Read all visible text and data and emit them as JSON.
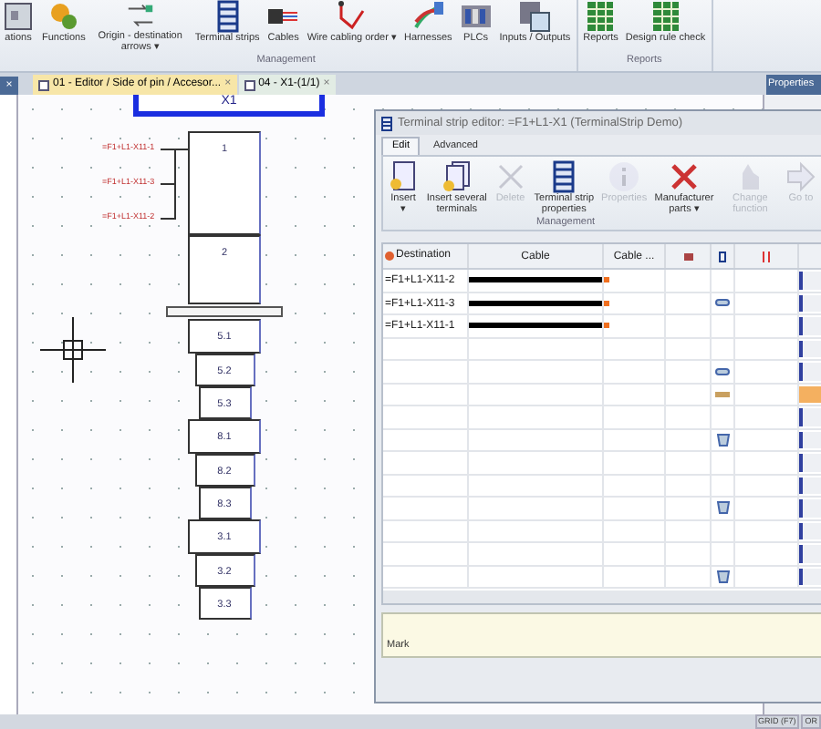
{
  "ribbon": {
    "groups": [
      {
        "label": "Management",
        "items": [
          {
            "label": "ations"
          },
          {
            "label": "Functions"
          },
          {
            "label": "Origin - destination arrows",
            "caret": "▾"
          },
          {
            "label": "Terminal strips"
          },
          {
            "label": "Cables"
          },
          {
            "label": "Wire cabling order",
            "caret": "▾"
          },
          {
            "label": "Harnesses"
          },
          {
            "label": "PLCs"
          },
          {
            "label": "Inputs / Outputs"
          }
        ]
      },
      {
        "label": "Reports",
        "items": [
          {
            "label": "Reports"
          },
          {
            "label": "Design rule check"
          }
        ]
      }
    ]
  },
  "left_panel": {
    "close": "×"
  },
  "doc_tabs": [
    {
      "label": "01 - Editor / Side of pin / Accesor...",
      "close": "×",
      "selected": false
    },
    {
      "label": "04 - X1-(1/1)",
      "close": "×",
      "selected": true
    }
  ],
  "properties_panel": {
    "title": "Properties"
  },
  "diagram": {
    "strip_title": "X1",
    "wire_labels": [
      "=F1+L1-X11-1",
      "=F1+L1-X11-3",
      "=F1+L1-X11-2"
    ],
    "terminals": [
      {
        "label": "1",
        "kind": "large"
      },
      {
        "label": "2",
        "kind": "medium"
      },
      {
        "kind": "bar"
      },
      {
        "label": "5.1",
        "kind": "wide"
      },
      {
        "label": "5.2",
        "kind": "mid"
      },
      {
        "label": "5.3",
        "kind": "narrow"
      },
      {
        "label": "8.1",
        "kind": "wide"
      },
      {
        "label": "8.2",
        "kind": "mid"
      },
      {
        "label": "8.3",
        "kind": "narrow"
      },
      {
        "label": "3.1",
        "kind": "wide"
      },
      {
        "label": "3.2",
        "kind": "mid"
      },
      {
        "label": "3.3",
        "kind": "narrow"
      }
    ]
  },
  "dialog": {
    "title": "Terminal strip editor: =F1+L1-X1 (TerminalStrip Demo)",
    "tabs": [
      {
        "label": "Edit",
        "selected": true
      },
      {
        "label": "Advanced",
        "selected": false
      }
    ],
    "buttons": [
      {
        "label": "Insert",
        "caret": "▾",
        "disabled": false
      },
      {
        "label": "Insert several terminals",
        "disabled": false
      },
      {
        "label": "Delete",
        "disabled": true
      },
      {
        "label": "Terminal strip properties",
        "disabled": false
      },
      {
        "label": "Properties",
        "disabled": true
      },
      {
        "label": "Manufacturer parts",
        "caret": "▾",
        "disabled": false
      },
      {
        "label": "Change function",
        "disabled": true
      },
      {
        "label": "Go to",
        "disabled": true
      }
    ],
    "group_label": "Management",
    "columns": [
      "Destination",
      "Cable",
      "Cable ..."
    ],
    "rows": [
      {
        "destination": "=F1+L1-X11-2",
        "wired": true,
        "kind": "plain",
        "highlighted": false
      },
      {
        "destination": "=F1+L1-X11-3",
        "wired": true,
        "kind": "link",
        "highlighted": false
      },
      {
        "destination": "=F1+L1-X11-1",
        "wired": true,
        "kind": "plain",
        "highlighted": false
      },
      {
        "wired": false,
        "kind": "plain",
        "highlighted": false
      },
      {
        "wired": false,
        "kind": "link",
        "highlighted": false
      },
      {
        "wired": false,
        "kind": "dash",
        "highlighted": true
      },
      {
        "wired": false,
        "kind": "plain",
        "highlighted": false
      },
      {
        "wired": false,
        "kind": "shield",
        "highlighted": false
      },
      {
        "wired": false,
        "kind": "plain",
        "highlighted": false
      },
      {
        "wired": false,
        "kind": "plain",
        "highlighted": false
      },
      {
        "wired": false,
        "kind": "shield",
        "highlighted": false
      },
      {
        "wired": false,
        "kind": "plain",
        "highlighted": false
      },
      {
        "wired": false,
        "kind": "plain",
        "highlighted": false
      },
      {
        "wired": false,
        "kind": "shield",
        "highlighted": false
      }
    ],
    "mark_label": "Mark"
  },
  "status_bar": {
    "items": [
      "GRID (F7)",
      "OR"
    ]
  }
}
